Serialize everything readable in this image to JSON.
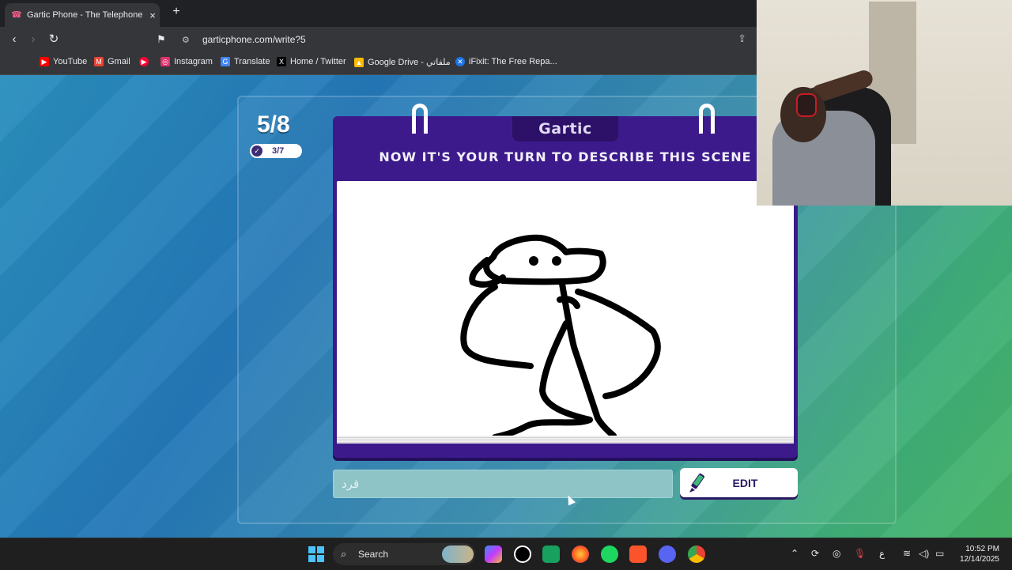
{
  "browser": {
    "tab_title": "Gartic Phone - The Telephone Ga",
    "tab_close": "×",
    "new_tab": "+",
    "url": "garticphone.com/write?5"
  },
  "bookmarks": [
    {
      "label": "YouTube",
      "icon": "youtube-icon",
      "color": "#ff0000"
    },
    {
      "label": "Gmail",
      "icon": "gmail-icon",
      "color": "#ea4335"
    },
    {
      "label": "",
      "icon": "youtube-red-icon",
      "color": "#ff0033"
    },
    {
      "label": "Instagram",
      "icon": "instagram-icon",
      "color": "#e1306c"
    },
    {
      "label": "Translate",
      "icon": "translate-icon",
      "color": "#4285f4"
    },
    {
      "label": "Home / Twitter",
      "icon": "x-icon",
      "color": "#000000"
    },
    {
      "label": "Google Drive - ملفاتي",
      "icon": "drive-icon",
      "color": "#fbbc04"
    },
    {
      "label": "iFixit: The Free Repa...",
      "icon": "ifixit-icon",
      "color": "#1b74e4"
    }
  ],
  "game": {
    "round": "5/8",
    "done_count": "3/7",
    "logo": "Gartic",
    "instruction": "NOW IT'S YOUR TURN TO DESCRIBE THIS SCENE",
    "input_placeholder": "قرد",
    "edit_label": "EDIT",
    "colors": {
      "card": "#3d1a8c",
      "accent": "#2a1863"
    }
  },
  "taskbar": {
    "search_label": "Search",
    "lang": "ع",
    "time": "10:52 PM",
    "date": "12/14/2025"
  }
}
